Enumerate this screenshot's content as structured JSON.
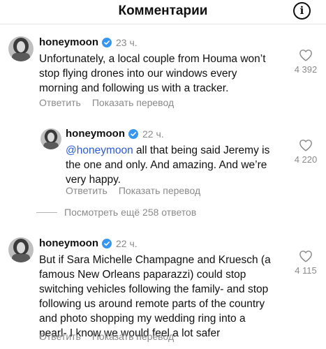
{
  "header": {
    "title": "Комментарии",
    "info_icon": "info-icon"
  },
  "comments": [
    {
      "username": "honeymoon",
      "time": "23 ч.",
      "text": "Unfortunately, a local couple from Houma won’t\nstop flying drones into our windows every\nmorning and following us with a tracker.",
      "likes": "4 392",
      "reply_label": "Ответить",
      "translate_label": "Показать перевод"
    },
    {
      "username": "honeymoon",
      "time": "22 ч.",
      "mention": "@honeymoon",
      "text": " all that being said Jeremy is\nthe one and only. And amazing. And we’re\nvery happy.",
      "likes": "4 220",
      "reply_label": "Ответить",
      "translate_label": "Показать перевод"
    },
    {
      "username": "honeymoon",
      "time": "22 ч.",
      "text": "But if Sara Michelle Champagne and Kruesch (a\nfamous New Orleans paparazzi) could stop\nswitching vehicles following the family- and  stop\nfollowing us around remote parts of the country\nand photo shopping my wedding ring into a\npearl- I know we would feel a lot safer",
      "likes": "4 115",
      "reply_label": "Ответить",
      "translate_label": "Показать перевод"
    }
  ],
  "view_more_replies": "Посмотреть ещё 258 ответов",
  "colors": {
    "verified": "#3797f0",
    "mention": "#2a5bd7",
    "muted": "#8a8a8a"
  }
}
